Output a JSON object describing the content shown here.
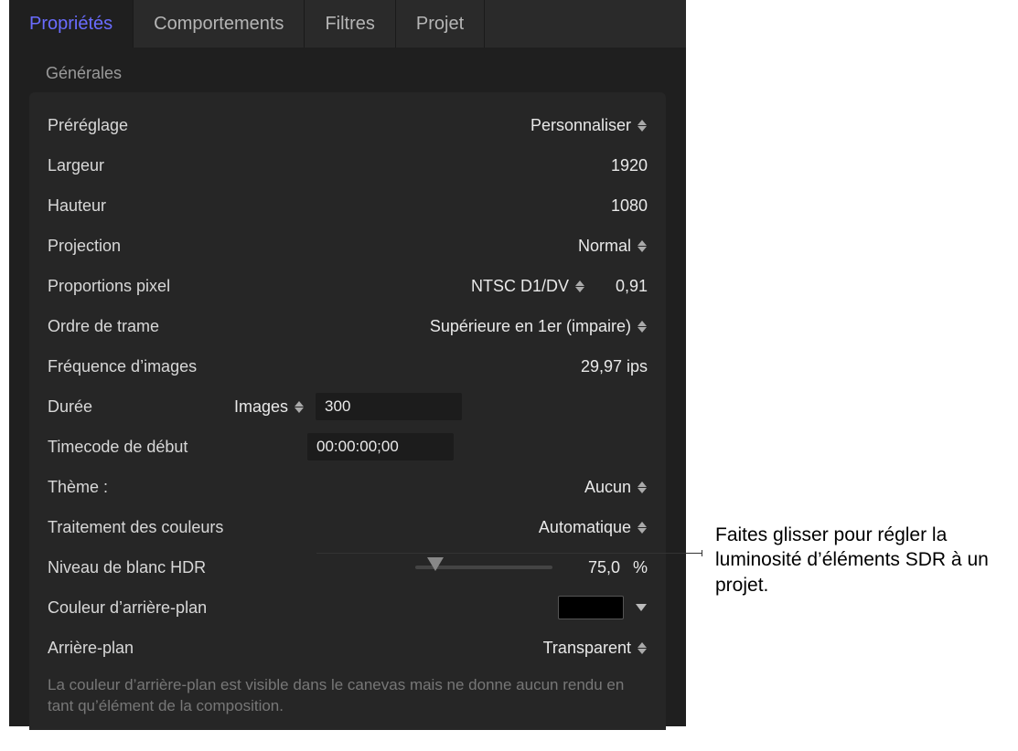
{
  "tabs": {
    "properties": "Propriétés",
    "behaviors": "Comportements",
    "filters": "Filtres",
    "project": "Projet"
  },
  "section_title": "Générales",
  "preset": {
    "label": "Préréglage",
    "value": "Personnaliser"
  },
  "width": {
    "label": "Largeur",
    "value": "1920"
  },
  "height": {
    "label": "Hauteur",
    "value": "1080"
  },
  "projection": {
    "label": "Projection",
    "value": "Normal"
  },
  "pixel_aspect": {
    "label": "Proportions pixel",
    "option": "NTSC D1/DV",
    "value": "0,91"
  },
  "field_order": {
    "label": "Ordre de trame",
    "value": "Supérieure en 1er (impaire)"
  },
  "frame_rate": {
    "label": "Fréquence d’images",
    "value": "29,97 ips"
  },
  "duration": {
    "label": "Durée",
    "unit": "Images",
    "value": "300"
  },
  "start_tc": {
    "label": "Timecode de début",
    "value": "00:00:00;00"
  },
  "theme": {
    "label": "Thème :",
    "value": "Aucun"
  },
  "color_processing": {
    "label": "Traitement des couleurs",
    "value": "Automatique"
  },
  "hdr_white": {
    "label": "Niveau de blanc HDR",
    "value": "75,0",
    "unit": "%",
    "slider_percent": 15
  },
  "bg_color": {
    "label": "Couleur d’arrière-plan"
  },
  "background": {
    "label": "Arrière-plan",
    "value": "Transparent"
  },
  "footnote": "La couleur d’arrière-plan est visible dans le canevas mais ne donne aucun rendu en tant qu’élément de la composition.",
  "callout": "Faites glisser pour régler la luminosité d’éléments SDR à un projet."
}
